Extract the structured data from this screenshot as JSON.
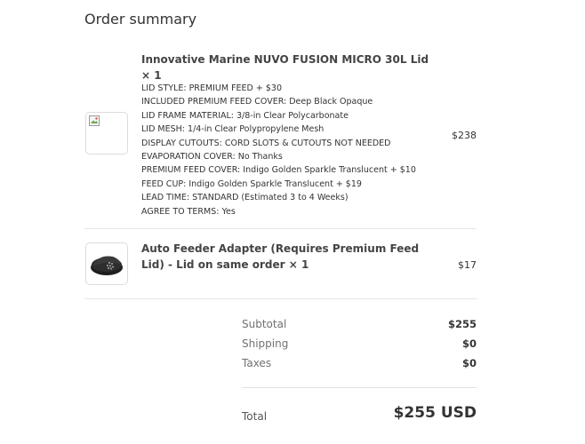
{
  "summary": {
    "title": "Order summary"
  },
  "items": [
    {
      "name": "Innovative Marine NUVO FUSION MICRO 30L Lid × 1",
      "properties": [
        "LID STYLE: PREMIUM FEED + $30",
        "INCLUDED PREMIUM FEED COVER: Deep Black Opaque",
        "LID FRAME MATERIAL: 3/8-in Clear Polycarbonate",
        "LID MESH: 1/4-in Clear Polypropylene Mesh",
        "DISPLAY CUTOUTS: CORD SLOTS & CUTOUTS NOT NEEDED",
        "EVAPORATION COVER: No Thanks",
        "PREMIUM FEED COVER: Indigo Golden Sparkle Translucent + $10",
        "FEED CUP: Indigo Golden Sparkle Translucent + $19",
        "LEAD TIME: STANDARD (Estimated 3 to 4 Weeks)",
        "AGREE TO TERMS: Yes"
      ],
      "price": "$238",
      "image": "broken-image-icon"
    },
    {
      "name": "Auto Feeder Adapter (Requires Premium Feed Lid) - Lid on same order × 1",
      "price": "$17",
      "image": "feeder-adapter-thumbnail"
    }
  ],
  "totals": {
    "subtotal_label": "Subtotal",
    "subtotal": "$255",
    "shipping_label": "Shipping",
    "shipping": "$0",
    "taxes_label": "Taxes",
    "taxes": "$0",
    "total_label": "Total",
    "total": "$255 USD"
  }
}
